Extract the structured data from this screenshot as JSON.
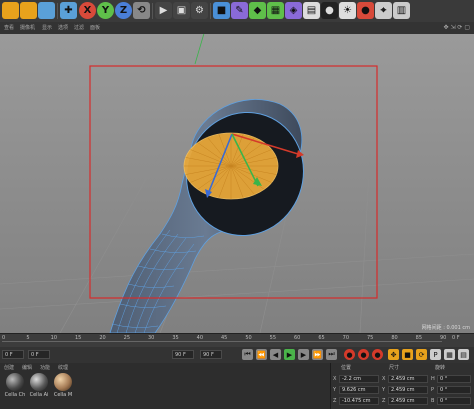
{
  "toolbar": {
    "icons": [
      "undo-icon",
      "redo-icon",
      "live-select-icon",
      "move-icon",
      "scale-icon",
      "rotate-icon",
      "x-axis-lock-icon",
      "y-axis-lock-icon",
      "z-axis-lock-icon",
      "coordinate-system-icon",
      "render-view-icon",
      "render-picture-viewer-icon",
      "edit-render-settings-icon",
      "cube-icon",
      "pen-icon",
      "subdivision-icon",
      "array-icon",
      "deformer-icon",
      "floor-icon",
      "camera-icon",
      "light-icon",
      "tag-icon",
      "snap-icon",
      "layout-icon"
    ],
    "axis_labels": {
      "x": "X",
      "y": "Y",
      "z": "Z"
    }
  },
  "menubar": {
    "items": [
      "查看",
      "摄像机",
      "显示",
      "选项",
      "过滤",
      "面板"
    ]
  },
  "viewport": {
    "status": "网格间距 : 0.001 cm"
  },
  "timeline": {
    "ticks": [
      "0",
      "5",
      "10",
      "15",
      "20",
      "25",
      "30",
      "35",
      "40",
      "45",
      "50",
      "55",
      "60",
      "65",
      "70",
      "75",
      "80",
      "85",
      "90"
    ],
    "end_label": "0 F"
  },
  "transport": {
    "current_frame": "0 F",
    "start_frame": "0 F",
    "end_frame": "90 F",
    "end_frame2": "90 F"
  },
  "materials": {
    "menu": [
      "创建",
      "编辑",
      "功能",
      "纹理"
    ],
    "items": [
      {
        "label": "Cella Ch",
        "color": "#4a4a4a"
      },
      {
        "label": "Cella Ai",
        "color": "#5a5a5a"
      },
      {
        "label": "Cella M",
        "color": "#a57b55"
      }
    ]
  },
  "coordinates": {
    "headers": {
      "position": "位置",
      "size": "尺寸",
      "rotation": "旋转"
    },
    "rows": [
      {
        "axis": "X",
        "pos": "-2.2 cm",
        "size_axis": "X",
        "size": "2.459 cm",
        "rot_axis": "H",
        "rot": "0 °"
      },
      {
        "axis": "Y",
        "pos": "9.626 cm",
        "size_axis": "Y",
        "size": "2.459 cm",
        "rot_axis": "P",
        "rot": "0 °"
      },
      {
        "axis": "Z",
        "pos": "-10.475 cm",
        "size_axis": "Z",
        "size": "2.459 cm",
        "rot_axis": "B",
        "rot": "0 °"
      }
    ]
  }
}
